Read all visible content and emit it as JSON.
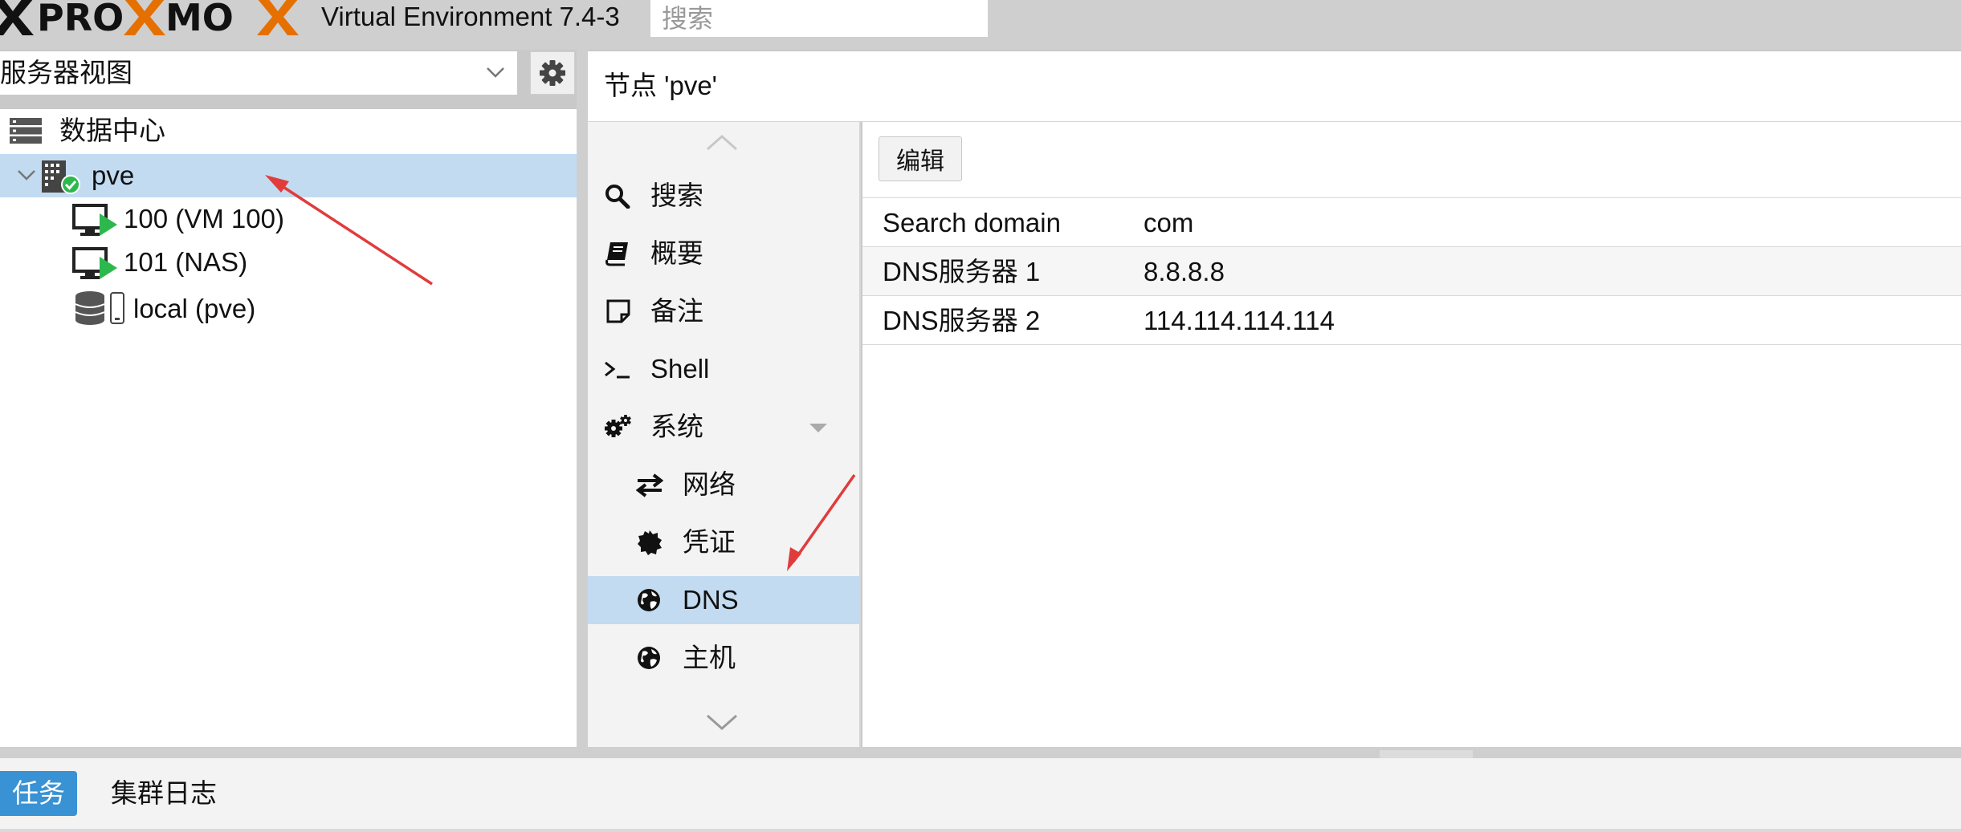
{
  "header": {
    "logo_text_1": "",
    "logo_text_2": "PRO",
    "logo_text_3": "MO",
    "version": "Virtual Environment 7.4-3",
    "search_placeholder": "搜索"
  },
  "left": {
    "view_label": "服务器视图",
    "tree": [
      {
        "label": "数据中心"
      },
      {
        "label": "pve"
      },
      {
        "label": "100 (VM 100)"
      },
      {
        "label": "101 (NAS)"
      },
      {
        "label": "local (pve)"
      }
    ]
  },
  "node": {
    "title": "节点 'pve'"
  },
  "menu": {
    "items": [
      {
        "label": "搜索"
      },
      {
        "label": "概要"
      },
      {
        "label": "备注"
      },
      {
        "label": "Shell"
      },
      {
        "label": "系统"
      },
      {
        "label": "网络"
      },
      {
        "label": "凭证"
      },
      {
        "label": "DNS"
      },
      {
        "label": "主机"
      }
    ]
  },
  "content": {
    "edit_label": "编辑",
    "rows": [
      {
        "key": "Search domain",
        "value": "com"
      },
      {
        "key": "DNS服务器 1",
        "value": "8.8.8.8"
      },
      {
        "key": "DNS服务器 2",
        "value": "114.114.114.114"
      }
    ]
  },
  "bottom": {
    "tabs": [
      {
        "label": "任务"
      },
      {
        "label": "集群日志"
      }
    ]
  },
  "colors": {
    "accent": "#3892d4",
    "selected": "#c2dbf1",
    "logo_orange": "#e57000",
    "status_green": "#2db84d",
    "annotation_red": "#e03c3c"
  }
}
